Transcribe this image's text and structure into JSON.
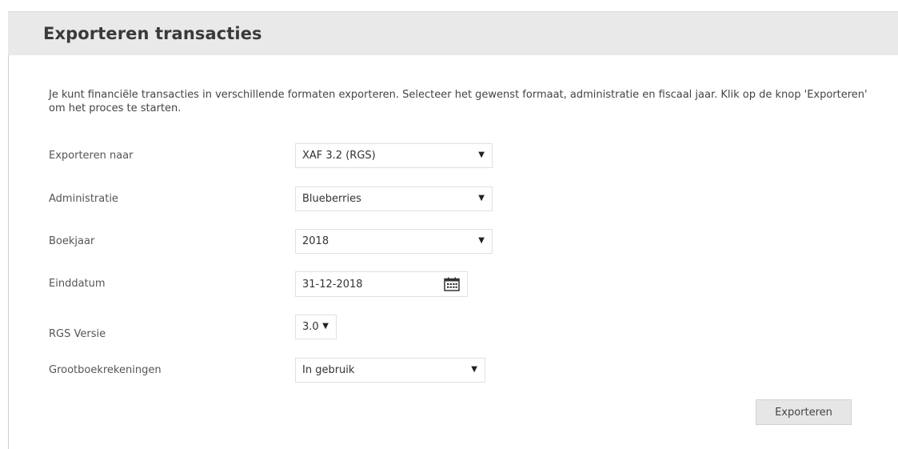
{
  "header": {
    "title": "Exporteren transacties"
  },
  "intro": {
    "text": "Je kunt financiële transacties in verschillende formaten exporteren. Selecteer het gewenst formaat, administratie en fiscaal jaar. Klik op de knop 'Exporteren' om het proces te starten."
  },
  "form": {
    "export_to": {
      "label": "Exporteren naar",
      "value": "XAF 3.2 (RGS)"
    },
    "administration": {
      "label": "Administratie",
      "value": "Blueberries"
    },
    "fiscal_year": {
      "label": "Boekjaar",
      "value": "2018"
    },
    "end_date": {
      "label": "Einddatum",
      "value": "31-12-2018"
    },
    "rgs_version": {
      "label": "RGS Versie",
      "value": "3.0"
    },
    "ledger_accounts": {
      "label": "Grootboekrekeningen",
      "value": "In gebruik"
    }
  },
  "actions": {
    "export_label": "Exporteren"
  },
  "icons": {
    "dropdown": "caret-down-icon",
    "calendar": "calendar-icon"
  },
  "colors": {
    "header_bg": "#e9e9e9",
    "button_bg": "#e6e6e6",
    "border": "#e0e0e0"
  }
}
